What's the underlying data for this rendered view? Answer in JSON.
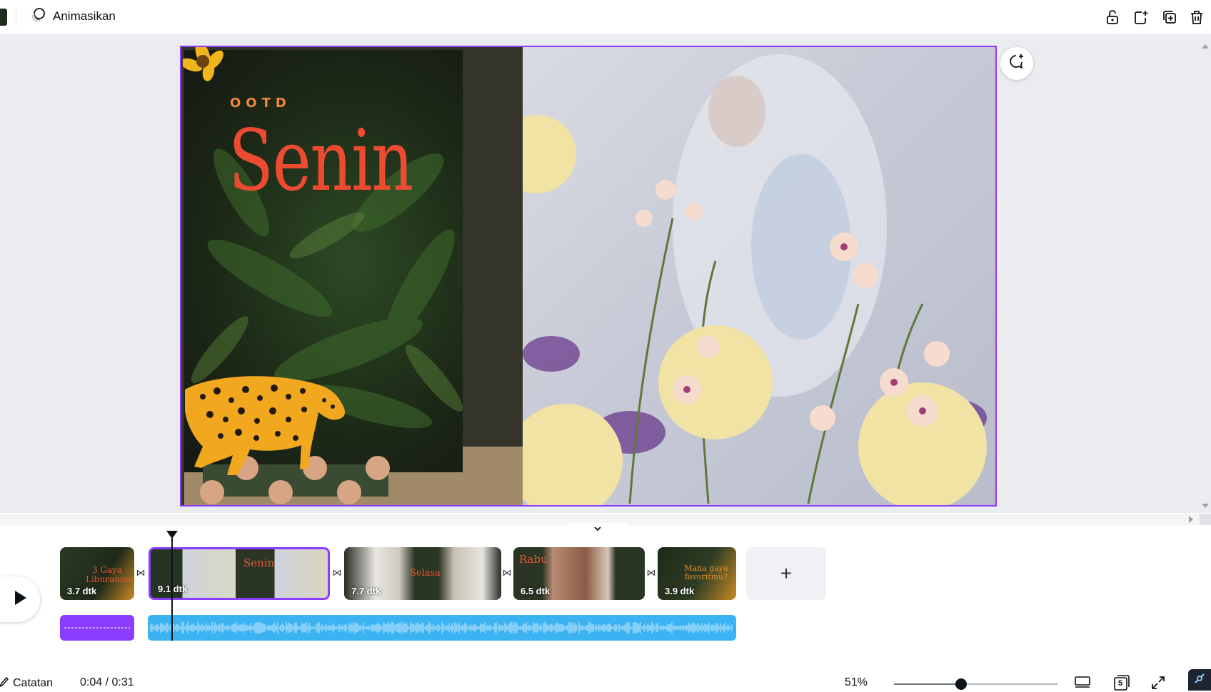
{
  "toolbar": {
    "animate_label": "Animasikan",
    "icons": [
      "lock-open-icon",
      "add-page-icon",
      "duplicate-page-icon",
      "trash-icon"
    ]
  },
  "design": {
    "small_heading": "OOTD",
    "big_heading": "Senin"
  },
  "colors": {
    "accent": "#8b3dff",
    "heading_red": "#ec4b31",
    "heading_orange": "#f1883b",
    "audio_blue": "#3bb2f1",
    "audio_purple": "#8b3dff"
  },
  "timeline": {
    "scenes": [
      {
        "duration": "3.7 dtk",
        "thumb_text": "3 Gaya Liburanmu",
        "selected": false
      },
      {
        "duration": "9.1 dtk",
        "thumb_text": "Senin",
        "selected": true
      },
      {
        "duration": "7.7 dtk",
        "thumb_text": "Selasa",
        "selected": false
      },
      {
        "duration": "6.5 dtk",
        "thumb_text": "Rabu",
        "selected": false
      },
      {
        "duration": "3.9 dtk",
        "thumb_text": "Mana gaya favoritmu?",
        "selected": false
      }
    ],
    "add_label": "+"
  },
  "footer": {
    "notes_label": "Catatan",
    "time": "0:04 / 0:31",
    "zoom": "51%",
    "zoom_fraction": 0.41,
    "page_count": "5"
  }
}
